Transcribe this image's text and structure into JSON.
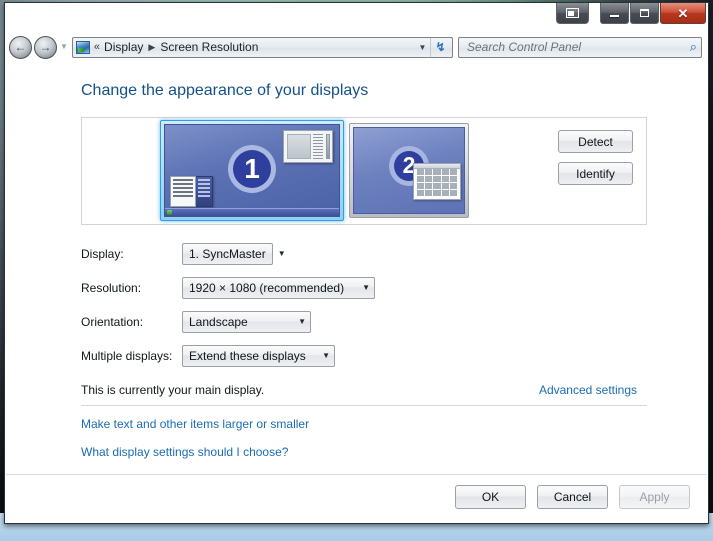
{
  "window": {
    "titlebar": {
      "aero_peek_label": "Show desktop preview",
      "minimize_label": "–",
      "maximize_label": "",
      "close_label": "✕"
    },
    "nav": {
      "back_label": "←",
      "forward_label": "→",
      "history_chevron": "▼"
    },
    "address": {
      "icon_name": "display-icon",
      "double_chevron": "«",
      "crumb_1": "Display",
      "crumb_arrow": "▶",
      "crumb_2": "Screen Resolution",
      "dropdown_arrow": "▼",
      "refresh_icon": "↯"
    },
    "search": {
      "placeholder": "Search Control Panel",
      "value": "",
      "icon": "⌕"
    }
  },
  "page": {
    "title": "Change the appearance of your displays"
  },
  "preview": {
    "monitors": [
      {
        "number": "1",
        "selected": true
      },
      {
        "number": "2",
        "selected": false
      }
    ],
    "detect_label": "Detect",
    "identify_label": "Identify"
  },
  "form": {
    "rows": [
      {
        "label": "Display:",
        "value": "1. SyncMaster",
        "arrow": "▼"
      },
      {
        "label": "Resolution:",
        "value": "1920 × 1080 (recommended)",
        "arrow": "▼"
      },
      {
        "label": "Orientation:",
        "value": "Landscape",
        "arrow": "▼"
      },
      {
        "label": "Multiple displays:",
        "value": "Extend these displays",
        "arrow": "▼"
      }
    ]
  },
  "status": {
    "main_display_text": "This is currently your main display.",
    "advanced_settings_link": "Advanced settings"
  },
  "links": {
    "make_text_larger": "Make text and other items larger or smaller",
    "what_display_settings": "What display settings should I choose?"
  },
  "footer": {
    "ok_label": "OK",
    "cancel_label": "Cancel",
    "apply_label": "Apply",
    "apply_disabled": true
  },
  "colors": {
    "heading": "#14518a",
    "link": "#1a6cb5",
    "selected_monitor_glow": "#2e9fe0",
    "monitor_badge": "#2f3f9e",
    "close_button": "#b8371f"
  }
}
